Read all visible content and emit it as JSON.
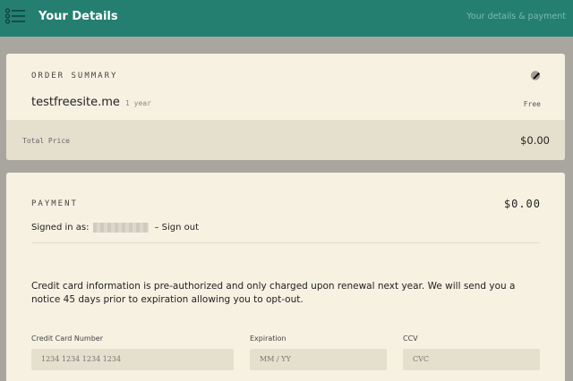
{
  "header": {
    "title": "Your Details",
    "breadcrumb": "Your details & payment"
  },
  "order_summary": {
    "label": "ORDER SUMMARY",
    "domain": "testfreesite.me",
    "term": "1 year",
    "price": "Free",
    "total_label": "Total Price",
    "total_value": "$0.00"
  },
  "payment": {
    "label": "PAYMENT",
    "amount": "$0.00",
    "signed_in_prefix": "Signed in as:",
    "sign_out": "– Sign out",
    "info_text": "Credit card information is pre-authorized and only charged upon renewal next year. We will send you a notice 45 days prior to expiration allowing you to opt-out.",
    "fields": {
      "card_number": {
        "label": "Credit Card Number",
        "placeholder": "1234 1234 1234 1234"
      },
      "expiration": {
        "label": "Expiration",
        "placeholder": "MM / YY"
      },
      "cvv": {
        "label": "CCV",
        "placeholder": "CVC"
      }
    }
  },
  "colors": {
    "header_bg": "#247f71",
    "page_bg": "#a8a69f",
    "card_bg": "#f7f1e2",
    "input_bg": "#e5dfcd"
  }
}
